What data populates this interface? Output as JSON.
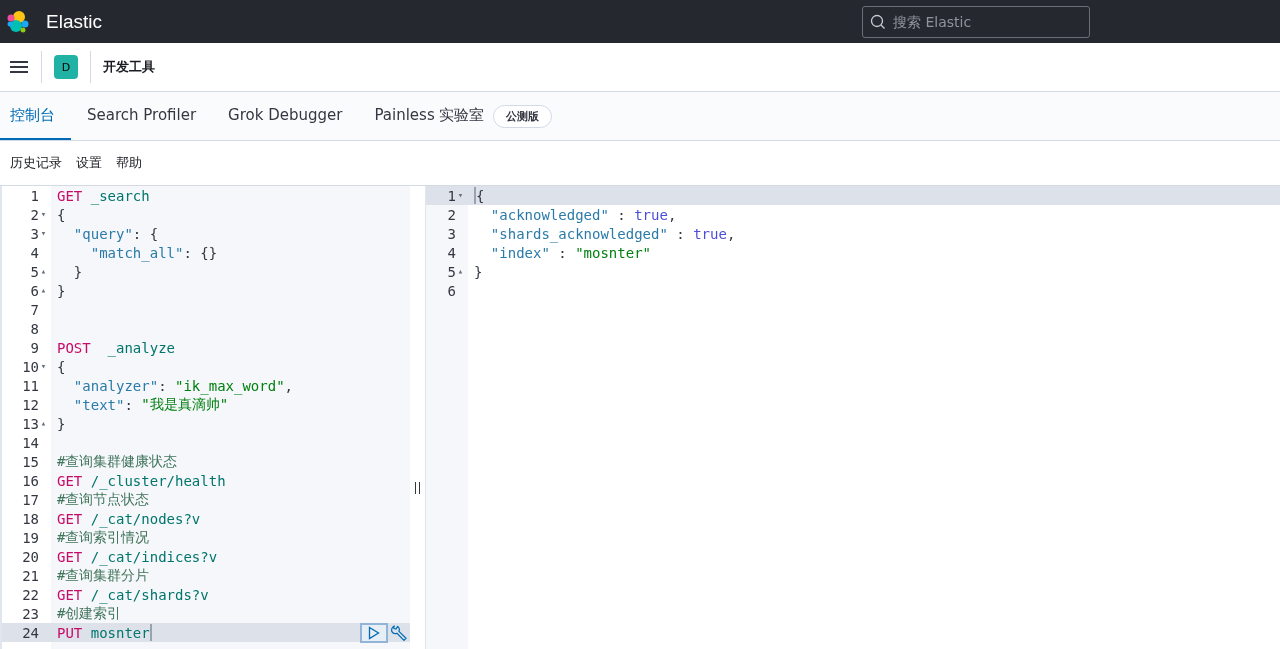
{
  "header": {
    "app_name": "Elastic",
    "search": {
      "placeholder": "搜索 Elastic"
    }
  },
  "breadcrumb": {
    "badge": "D",
    "title": "开发工具"
  },
  "tabs": [
    {
      "label": "控制台",
      "selected": true
    },
    {
      "label": "Search Profiler",
      "selected": false
    },
    {
      "label": "Grok Debugger",
      "selected": false
    },
    {
      "label": "Painless 实验室",
      "selected": false,
      "badge": "公测版"
    }
  ],
  "toolbar": [
    "历史记录",
    "设置",
    "帮助"
  ],
  "request_editor": {
    "lines": [
      {
        "number": "1",
        "active": false,
        "tokens": [
          {
            "kind": "method",
            "text": "GET"
          },
          {
            "kind": "url",
            "text": " _search"
          }
        ]
      },
      {
        "number": "2",
        "fold": "▾",
        "active": false,
        "tokens": [
          {
            "kind": "punct",
            "text": "{"
          }
        ]
      },
      {
        "number": "3",
        "fold": "▾",
        "active": false,
        "tokens": [
          {
            "kind": "key",
            "text": "  \"query\""
          },
          {
            "kind": "punct",
            "text": ": {"
          }
        ]
      },
      {
        "number": "4",
        "active": false,
        "tokens": [
          {
            "kind": "key",
            "text": "    \"match_all\""
          },
          {
            "kind": "punct",
            "text": ": {}"
          }
        ]
      },
      {
        "number": "5",
        "fold": "▴",
        "active": false,
        "tokens": [
          {
            "kind": "punct",
            "text": "  }"
          }
        ]
      },
      {
        "number": "6",
        "fold": "▴",
        "active": false,
        "tokens": [
          {
            "kind": "punct",
            "text": "}"
          }
        ]
      },
      {
        "number": "7",
        "active": false
      },
      {
        "number": "8",
        "active": false
      },
      {
        "number": "9",
        "active": false,
        "tokens": [
          {
            "kind": "method",
            "text": "POST"
          },
          {
            "kind": "url",
            "text": "  _analyze"
          }
        ]
      },
      {
        "number": "10",
        "fold": "▾",
        "active": false,
        "tokens": [
          {
            "kind": "punct",
            "text": "{"
          }
        ]
      },
      {
        "number": "11",
        "active": false,
        "tokens": [
          {
            "kind": "key",
            "text": "  \"analyzer\""
          },
          {
            "kind": "punct",
            "text": ": "
          },
          {
            "kind": "string",
            "text": "\"ik_max_word\""
          },
          {
            "kind": "punct",
            "text": ","
          }
        ]
      },
      {
        "number": "12",
        "active": false,
        "tokens": [
          {
            "kind": "key",
            "text": "  \"text\""
          },
          {
            "kind": "punct",
            "text": ": "
          },
          {
            "kind": "string",
            "text": "\"我是真滴帅\""
          }
        ]
      },
      {
        "number": "13",
        "fold": "▴",
        "active": false,
        "tokens": [
          {
            "kind": "punct",
            "text": "}"
          }
        ]
      },
      {
        "number": "14",
        "active": false
      },
      {
        "number": "15",
        "active": false,
        "tokens": [
          {
            "kind": "comment",
            "text": "#查询集群健康状态"
          }
        ]
      },
      {
        "number": "16",
        "active": false,
        "tokens": [
          {
            "kind": "method",
            "text": "GET"
          },
          {
            "kind": "url",
            "text": " /_cluster/health"
          }
        ]
      },
      {
        "number": "17",
        "active": false,
        "tokens": [
          {
            "kind": "comment",
            "text": "#查询节点状态"
          }
        ]
      },
      {
        "number": "18",
        "active": false,
        "tokens": [
          {
            "kind": "method",
            "text": "GET"
          },
          {
            "kind": "url",
            "text": " /_cat/nodes?v"
          }
        ]
      },
      {
        "number": "19",
        "active": false,
        "tokens": [
          {
            "kind": "comment",
            "text": "#查询索引情况"
          }
        ]
      },
      {
        "number": "20",
        "active": false,
        "tokens": [
          {
            "kind": "method",
            "text": "GET"
          },
          {
            "kind": "url",
            "text": " /_cat/indices?v"
          }
        ]
      },
      {
        "number": "21",
        "active": false,
        "tokens": [
          {
            "kind": "comment",
            "text": "#查询集群分片"
          }
        ]
      },
      {
        "number": "22",
        "active": false,
        "tokens": [
          {
            "kind": "method",
            "text": "GET"
          },
          {
            "kind": "url",
            "text": " /_cat/shards?v"
          }
        ]
      },
      {
        "number": "23",
        "active": false,
        "tokens": [
          {
            "kind": "comment",
            "text": "#创建索引"
          }
        ]
      },
      {
        "number": "24",
        "active": true,
        "tokens": [
          {
            "kind": "method",
            "text": "PUT"
          },
          {
            "kind": "url",
            "text": " mosnter"
          },
          {
            "kind": "cursor"
          }
        ]
      }
    ]
  },
  "response_editor": {
    "lines": [
      {
        "number": "1",
        "fold": "▾",
        "active": true,
        "tokens": [
          {
            "kind": "cursor"
          },
          {
            "kind": "punct",
            "text": "{"
          }
        ]
      },
      {
        "number": "2",
        "active": false,
        "tokens": [
          {
            "kind": "key",
            "text": "  \"acknowledged\""
          },
          {
            "kind": "punct",
            "text": " : "
          },
          {
            "kind": "bool",
            "text": "true"
          },
          {
            "kind": "punct",
            "text": ","
          }
        ]
      },
      {
        "number": "3",
        "active": false,
        "tokens": [
          {
            "kind": "key",
            "text": "  \"shards_acknowledged\""
          },
          {
            "kind": "punct",
            "text": " : "
          },
          {
            "kind": "bool",
            "text": "true"
          },
          {
            "kind": "punct",
            "text": ","
          }
        ]
      },
      {
        "number": "4",
        "active": false,
        "tokens": [
          {
            "kind": "key",
            "text": "  \"index\""
          },
          {
            "kind": "punct",
            "text": " : "
          },
          {
            "kind": "string",
            "text": "\"mosnter\""
          }
        ]
      },
      {
        "number": "5",
        "fold": "▴",
        "active": false,
        "tokens": [
          {
            "kind": "punct",
            "text": "}"
          }
        ]
      },
      {
        "number": "6",
        "active": false
      }
    ]
  }
}
